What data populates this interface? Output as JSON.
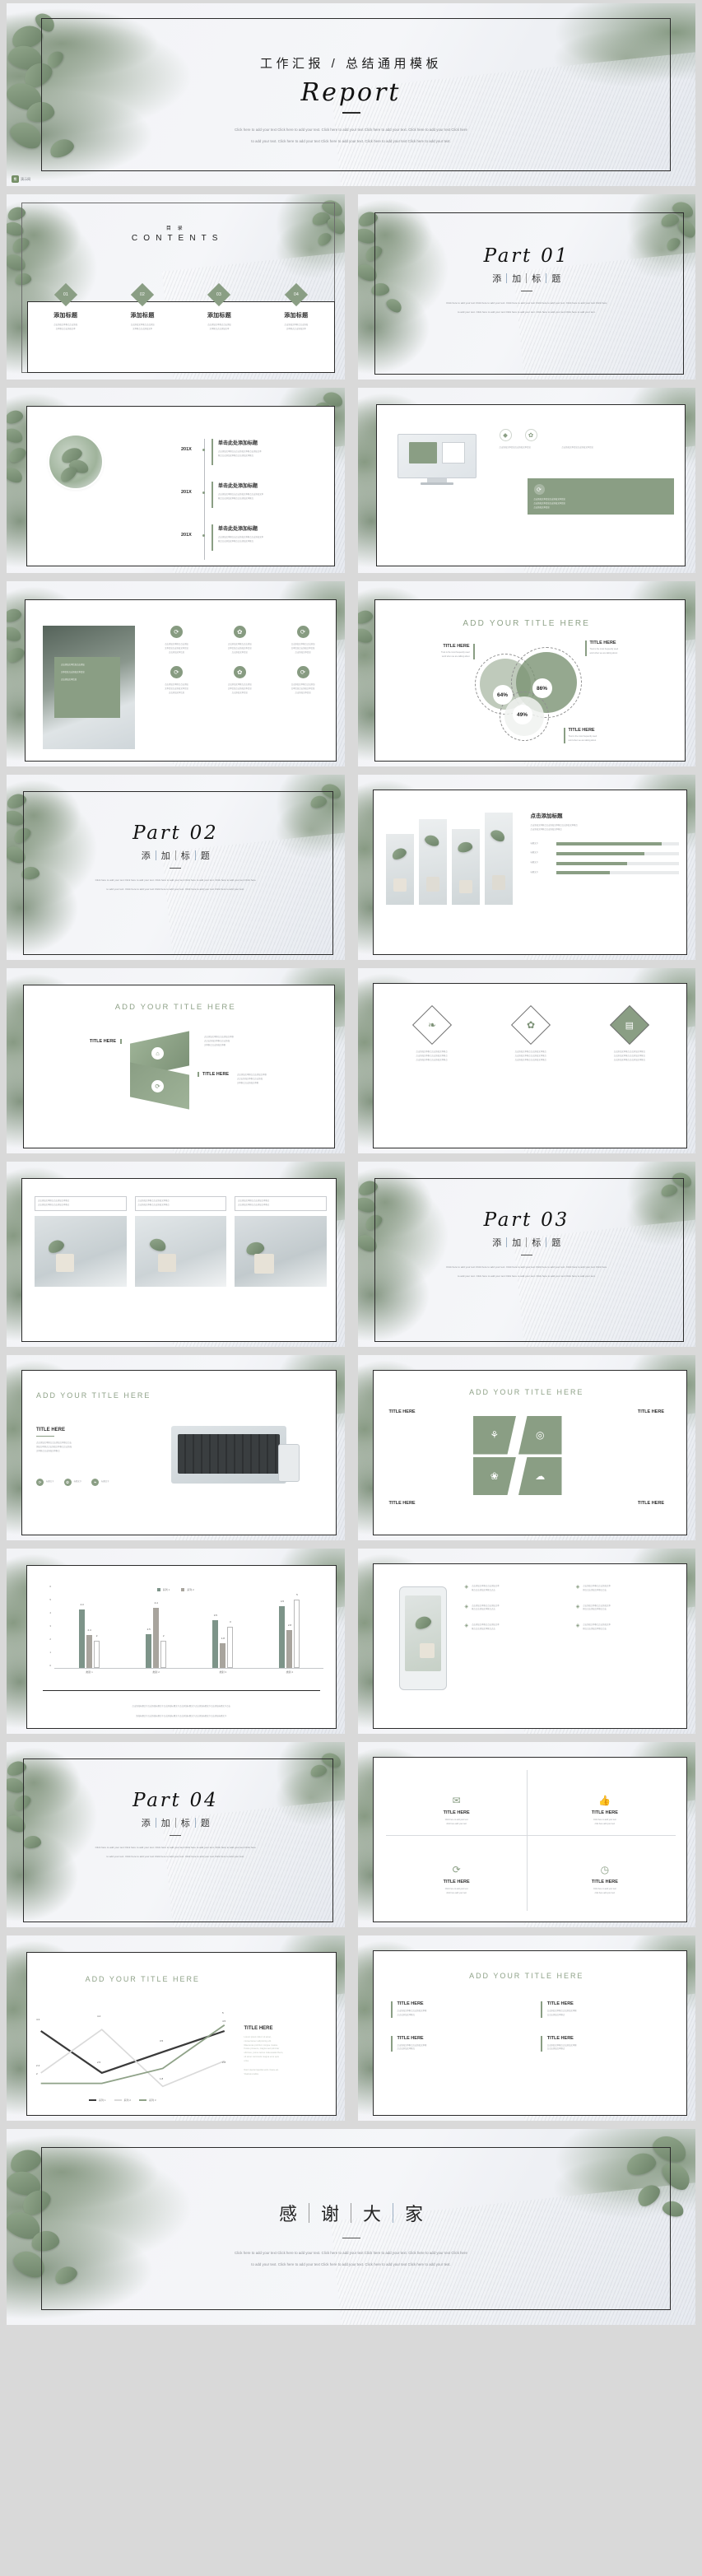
{
  "theme": {
    "accent_green": "#8a9e84",
    "accent_light": "#a8b7a2",
    "ink": "#1b1b1b",
    "muted": "#8b8e93",
    "page_bg": "#d9d9d9",
    "slide_bg": "#f3f4f7"
  },
  "watermark": {
    "badge": "熊",
    "text": "演示网"
  },
  "filler": {
    "en_long_1": "Click here to add your text Click here to add your text.   Click here to add your text Click here to add your text.   Click here to add your text Click here",
    "en_long_2": "to add your text.    Click here to add your text Click here to add your text.    Click here to add your text Click here to add your text.",
    "cn_para_1": "点击添加文本框点点击添加文本框点点击添加文本框点点击添加文本框点",
    "cn_para_2": "点击添加文本框点点击添加文本框点点击添加文本框点",
    "cn_block_1": "点击添加文本信息点击添加",
    "cn_block_2": "文本信息点击添加文本信息",
    "cn_block_3": "点击添加文本信息",
    "lorem_1": "Lorem ipsum dolor sit amet,",
    "lorem_2": "consectetuer adipiscing elit.",
    "lorem_3": "Maecenas porttitor congue massa.",
    "lorem_4": "Fusce posuere, magna sed pulvinar",
    "lorem_5": "ultricies, purus lectus malesuada libero,",
    "lorem_6": "sit amet commodo magna eros quis",
    "lorem_7": "urna.",
    "lorem_8": "Nunc viverra imperdiet enim. Fusce est.",
    "lorem_9": "Vivamus a tellus.",
    "trust_1": "Trust is the most frequently used",
    "trust_2": "word when we are talking about",
    "cn_long_chart": "点击添加标题文字点击添加标题文字点击添加标题文字点击添加标题文字点击添加标题文字点击添加标题文字点击",
    "cn_long_chart_2": "添加标题文字点击添加标题文字点击添加标题文字点击添加标题文字点击添加标题文字点击添加标题文字"
  },
  "slides": {
    "cover": {
      "title_cn": "工作汇报 / 总结通用模板",
      "title_en": "Report",
      "body_1": "Click here to add your text Click here to add your text.   Click here to add your text Click here to add your text.   Click here to add your text Click here",
      "body_2": "to add your text.    Click here to add your text Click here to add your text.    Click here to add your text Click here to add your text."
    },
    "contents": {
      "heading_cn": "目      录",
      "heading_en": "C O N T E N T S",
      "items": [
        {
          "num": "01",
          "title": "添加标题",
          "line1": "点击添加文本框点点击添加",
          "line2": "文本框点点击添加文本"
        },
        {
          "num": "02",
          "title": "添加标题",
          "line1": "点击添加文本框点点击添加",
          "line2": "文本框点点击添加文本"
        },
        {
          "num": "03",
          "title": "添加标题",
          "line1": "点击添加文本框点点击添加",
          "line2": "文本框点点击添加文本"
        },
        {
          "num": "04",
          "title": "添加标题",
          "line1": "点击添加文本框点点击添加",
          "line2": "文本框点点击添加文本"
        }
      ]
    },
    "part01": {
      "en": "Part 01",
      "cn": [
        "添",
        "加",
        "标",
        "题"
      ]
    },
    "part02": {
      "en": "Part 02",
      "cn": [
        "添",
        "加",
        "标",
        "题"
      ]
    },
    "part03": {
      "en": "Part 03",
      "cn": [
        "添",
        "加",
        "标",
        "题"
      ]
    },
    "part04": {
      "en": "Part 04",
      "cn": [
        "添",
        "加",
        "标",
        "题"
      ]
    },
    "timeline": {
      "entries": [
        {
          "year": "201X",
          "title": "单击此处添加标题",
          "line1": "点击添加文本框点击点击添加文本框点击添加文本",
          "line2": "框点点击添加文本框点点击添加文本框点"
        },
        {
          "year": "201X",
          "title": "单击此处添加标题",
          "line1": "点击添加文本框点击点击添加文本框点点击添加文本",
          "line2": "框点点击添加文本框点点击添加文本框点"
        },
        {
          "year": "201X",
          "title": "单击此处添加标题",
          "line1": "点击添加文本框点击点击添加文本框点点击添加文本",
          "line2": "框点点击添加文本框点点击添加文本框点"
        }
      ]
    },
    "device": {
      "icons": [
        "diamond-icon",
        "gear-icon",
        "refresh-icon"
      ],
      "panel_line1": "点击添加文本信息点击添加文本信息",
      "panel_line2": "点击添加文本信息点击添加文本信息",
      "panel_line3": "点击添加文本信息"
    },
    "icon_grid": {
      "overlay_lines": [
        "点击添加文本信息点击添加",
        "文本信息点击添加文本信息",
        "点击添加文本信息"
      ],
      "cells": [
        {
          "icon": "refresh-icon",
          "l1": "点击添加文本框点点击添加",
          "l2": "文本信息点击添加文本信息",
          "l3": "点击添加文本信息"
        },
        {
          "icon": "gear-icon",
          "l1": "点击添加文本框点点击添加",
          "l2": "文本信息点击添加文本信息",
          "l3": "点击添加文本信息"
        },
        {
          "icon": "refresh-icon",
          "l1": "点击添加文本框点点击添加",
          "l2": "文本信息点击添加文本信息",
          "l3": "点击添加文本信息"
        },
        {
          "icon": "refresh-icon",
          "l1": "点击添加文本框点点击添加",
          "l2": "文本信息点击添加文本信息",
          "l3": "点击添加文本信息"
        },
        {
          "icon": "gear-icon",
          "l1": "点击添加文本框点点击添加",
          "l2": "文本信息点击添加文本信息",
          "l3": "点击添加文本信息"
        },
        {
          "icon": "refresh-icon",
          "l1": "点击添加文本框点点击添加",
          "l2": "文本信息点击添加文本信息",
          "l3": "点击添加文本信息"
        }
      ]
    },
    "venn": {
      "heading": "ADD YOUR TITLE HERE",
      "labels": [
        {
          "title": "TITLE HERE",
          "l1": "Trust is the most frequently used",
          "l2": "word when we are talking about",
          "align": "right"
        },
        {
          "title": "TITLE HERE",
          "l1": "Trust is the most frequently used",
          "l2": "word when we are talking about",
          "align": "left"
        },
        {
          "title": "TITLE HERE",
          "l1": "Trust is the most frequently used",
          "l2": "word when we are talking about",
          "align": "left"
        }
      ]
    },
    "pots_chart": {
      "heading": "点击添加标题",
      "desc_1": "点击添加文本框点点击添加文本框点点击添加文本框点",
      "desc_2": "点击添加文本框点点击添加文本框点",
      "bars": [
        {
          "label": "标题文字",
          "pct": 86
        },
        {
          "label": "标题文字",
          "pct": 72
        },
        {
          "label": "标题文字",
          "pct": 58
        },
        {
          "label": "标题文字",
          "pct": 44
        }
      ]
    },
    "ribbon": {
      "heading": "ADD YOUR TITLE HERE",
      "blocks": [
        {
          "title": "TITLE HERE",
          "icon": "home-icon",
          "l1": "点击添加文本框点点击添加文本框",
          "l2": "点点击添加文本框点点击添加",
          "l3": "文本框点点击添加文本框"
        },
        {
          "title": "TITLE HERE",
          "icon": "refresh-icon",
          "l1": "点击添加文本框点点击添加文本框",
          "l2": "点点击添加文本框点点击添加",
          "l3": "文本框点点击添加文本框"
        }
      ]
    },
    "diamonds3": {
      "items": [
        {
          "icon": "leaf-icon",
          "l1": "点击添加文本框点点击添加文本框点",
          "l2": "点击添加文本框点点击添加文本框点",
          "l3": "点击添加文本框点点击添加文本框点"
        },
        {
          "icon": "gear-icon",
          "l1": "点击添加文本框点点击添加文本框点",
          "l2": "点击添加文本框点点击添加文本框点",
          "l3": "点击添加文本框点点击添加文本框点"
        },
        {
          "icon": "chart-icon",
          "l1": "点击添加文本框点点击添加文本框点",
          "l2": "点击添加文本框点点击添加文本框点",
          "l3": "点击添加文本框点点击添加文本框点"
        }
      ]
    },
    "three_photo": {
      "cards": [
        {
          "l1": "点击添加文本框点点击添加文本框点",
          "l2": "点击添加文本框点点击添加文本框点"
        },
        {
          "l1": "点击添加文本框点点击添加文本框点",
          "l2": "点击添加文本框点点击添加文本框点"
        },
        {
          "l1": "点击添加文本框点点击添加文本框点",
          "l2": "点击添加文本框点点击添加文本框点"
        }
      ]
    },
    "laptop": {
      "heading": "ADD YOUR TITLE HERE",
      "title": "TITLE HERE",
      "l1": "点击添加文本框点点击添加文本框点点击",
      "l2": "添加文本框点点击添加文本框点点击添加",
      "l3": "文本框点点击添加文本框点",
      "chips": [
        {
          "icon": "refresh-icon",
          "label": "标题文字"
        },
        {
          "icon": "gear-icon",
          "label": "标题文字"
        },
        {
          "icon": "leaf-icon",
          "label": "标题文字"
        }
      ]
    },
    "four_panel": {
      "heading": "ADD YOUR TITLE HERE",
      "panels": [
        {
          "title": "TITLE HERE",
          "icon": "share-icon",
          "align": "left"
        },
        {
          "title": "TITLE HERE",
          "icon": "target-icon",
          "align": "right"
        },
        {
          "title": "TITLE HERE",
          "icon": "people-icon",
          "align": "left"
        },
        {
          "title": "TITLE HERE",
          "icon": "cloud-icon",
          "align": "right"
        }
      ]
    },
    "bar_chart": {
      "desc_1": "点击添加标题文字点击添加标题文字点击添加标题文字点击添加标题文字点击添加标题文字点击添加标题文字点击",
      "desc_2": "添加标题文字点击添加标题文字点击添加标题文字点击添加标题文字点击添加标题文字点击添加标题文字"
    },
    "phone_list": {
      "rows": [
        {
          "l1": "点击添加文本框点点击添加文本",
          "l2": "框点点击添加文本框点点击"
        },
        {
          "l1": "点击添加文本框点点击添加文本",
          "l2": "框点点击添加文本框点点击"
        },
        {
          "l1": "点击添加文本框点点击添加文本",
          "l2": "框点点击添加文本框点点击"
        },
        {
          "l1": "点击添加文本框点点击添加文本",
          "l2": "框点点击添加文本框点点击"
        },
        {
          "l1": "点击添加文本框点点击添加文本",
          "l2": "框点点击添加文本框点点击"
        },
        {
          "l1": "点击添加文本框点点击添加文本",
          "l2": "框点点击添加文本框点点击"
        }
      ]
    },
    "mail_grid": {
      "cells": [
        {
          "icon": "mail-icon",
          "title": "TITLE HERE",
          "l1": "Click here to add your text",
          "l2": "click here add your text"
        },
        {
          "icon": "thumb-icon",
          "title": "TITLE HERE",
          "l1": "Click here to add your text",
          "l2": "click here add your text"
        },
        {
          "icon": "refresh-icon",
          "title": "TITLE HERE",
          "l1": "Click here to add your text",
          "l2": "click here add your text"
        },
        {
          "icon": "clock-icon",
          "title": "TITLE HERE",
          "l1": "Click here to add your text",
          "l2": "click here add your text"
        }
      ]
    },
    "line_chart_slide": {
      "heading": "ADD YOUR TITLE HERE",
      "title": "TITLE HERE"
    },
    "text_two_col": {
      "heading": "ADD YOUR TITLE HERE",
      "blocks": [
        {
          "title": "TITLE HERE",
          "l1": "点击添加文本框点点击添加文本框",
          "l2": "点点击添加文本框点"
        },
        {
          "title": "TITLE HERE",
          "l1": "点击添加文本框点点击添加文本框",
          "l2": "点点击添加文本框点"
        },
        {
          "title": "TITLE HERE",
          "l1": "点击添加文本框点点击添加文本框",
          "l2": "点点击添加文本框点"
        },
        {
          "title": "TITLE HERE",
          "l1": "点击添加文本框点点击添加文本框",
          "l2": "点点击添加文本框点"
        }
      ]
    },
    "thanks": {
      "cn": [
        "感",
        "谢",
        "大",
        "家"
      ],
      "body_1": "Click here to add your text Click here to add your text.   Click here to add your text Click here to add your text.   Click here to add your text Click here",
      "body_2": "to add your text.    Click here to add your text Click here to add your text.    Click here to add your text Click here to add your text."
    }
  },
  "chart_data": [
    {
      "type": "bar",
      "title": "",
      "categories": [
        "类别 1",
        "类别 2",
        "类别 3",
        "类别 4"
      ],
      "series": [
        {
          "name": "系列 1",
          "values": [
            4.3,
            2.5,
            3.5,
            4.5
          ],
          "color": "#7d9489"
        },
        {
          "name": "系列 2",
          "values": [
            2.4,
            4.4,
            1.8,
            2.8
          ],
          "color": "#a8a49d"
        },
        {
          "name": "系列 3",
          "values": [
            2,
            2,
            3,
            5
          ],
          "color": "#ffffff"
        }
      ],
      "ylim": [
        0,
        6
      ],
      "yticks": [
        0,
        1,
        2,
        3,
        4,
        5,
        6
      ],
      "legend": [
        "系列 1",
        "系列 2"
      ],
      "legend_position": "top-center",
      "grid": false
    },
    {
      "type": "line",
      "title": "",
      "categories": [
        "类别 1",
        "类别 2",
        "类别 3",
        "类别 4"
      ],
      "series": [
        {
          "name": "系列 1",
          "values": [
            4.3,
            2.5,
            3.5,
            4.5
          ],
          "color": "#3a3a3a"
        },
        {
          "name": "系列 2",
          "values": [
            2.4,
            4.4,
            1.8,
            2.8
          ],
          "color": "#d5d5d5"
        },
        {
          "name": "系列 3",
          "values": [
            2,
            2,
            3,
            5
          ],
          "color": "#8fa288"
        }
      ],
      "legend": [
        "系列 1",
        "系列 2",
        "系列 3"
      ],
      "legend_position": "bottom-center",
      "ylim": [
        0,
        6
      ],
      "grid": false
    },
    {
      "type": "bar",
      "orientation": "horizontal",
      "title": "点击添加标题",
      "categories": [
        "标题文字",
        "标题文字",
        "标题文字",
        "标题文字"
      ],
      "values": [
        86,
        72,
        58,
        44
      ],
      "xlim": [
        0,
        100
      ],
      "grid": false
    },
    {
      "type": "pie",
      "title": "ADD YOUR TITLE HERE",
      "labels": [
        "64%",
        "86%",
        "49%"
      ],
      "values": [
        64,
        86,
        49
      ],
      "note": "overlapping venn circles"
    }
  ]
}
